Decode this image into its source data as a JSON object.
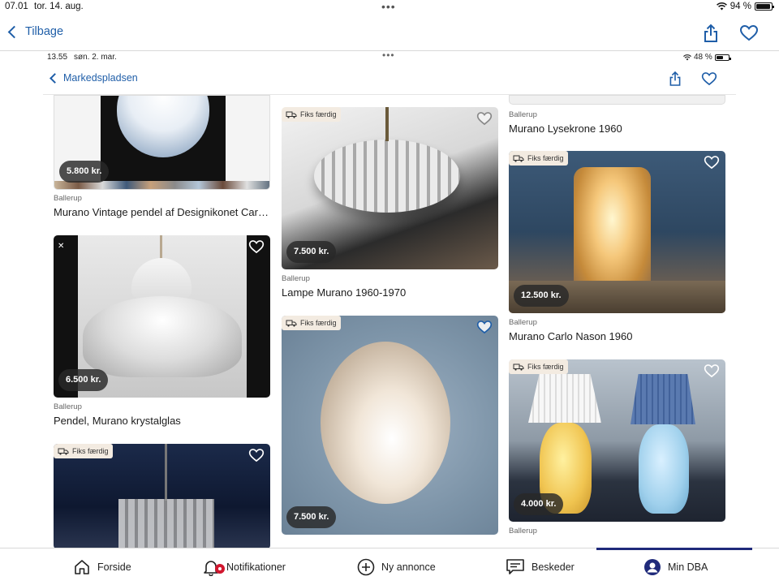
{
  "outer_status": {
    "time": "07.01",
    "date": "tor. 14. aug.",
    "battery": "94 %"
  },
  "outer_nav": {
    "back_label": "Tilbage"
  },
  "inner_status": {
    "time": "13.55",
    "date": "søn. 2. mar.",
    "battery": "48 %"
  },
  "inner_nav": {
    "back_label": "Markedspladsen"
  },
  "badge_label": "Fiks færdig",
  "listings": [
    {
      "price": "5.800 kr.",
      "location": "Ballerup",
      "title": "Murano Vintage pendel af Designikonet Carlo..."
    },
    {
      "price": "6.500 kr.",
      "location": "Ballerup",
      "title": "Pendel, Murano krystalglas"
    },
    {
      "price": "",
      "location": "",
      "title": ""
    },
    {
      "price": "7.500 kr.",
      "location": "Ballerup",
      "title": "Lampe Murano 1960-1970"
    },
    {
      "price": "7.500 kr.",
      "location": "",
      "title": ""
    },
    {
      "price": "",
      "location": "Ballerup",
      "title": "Murano Lysekrone 1960"
    },
    {
      "price": "12.500 kr.",
      "location": "Ballerup",
      "title": "Murano Carlo Nason 1960"
    },
    {
      "price": "4.000 kr.",
      "location": "Ballerup",
      "title": ""
    }
  ],
  "tabs": {
    "home": "Forside",
    "notifications": "Notifikationer",
    "new_ad": "Ny annonce",
    "messages": "Beskeder",
    "my_dba": "Min DBA"
  },
  "colors": {
    "accent": "#1f5ea8",
    "tab_indicator": "#1f2a7a",
    "badge_bg": "#f3ebe1",
    "price_bg": "#2a2a2a",
    "notification_dot": "#d1162e"
  }
}
